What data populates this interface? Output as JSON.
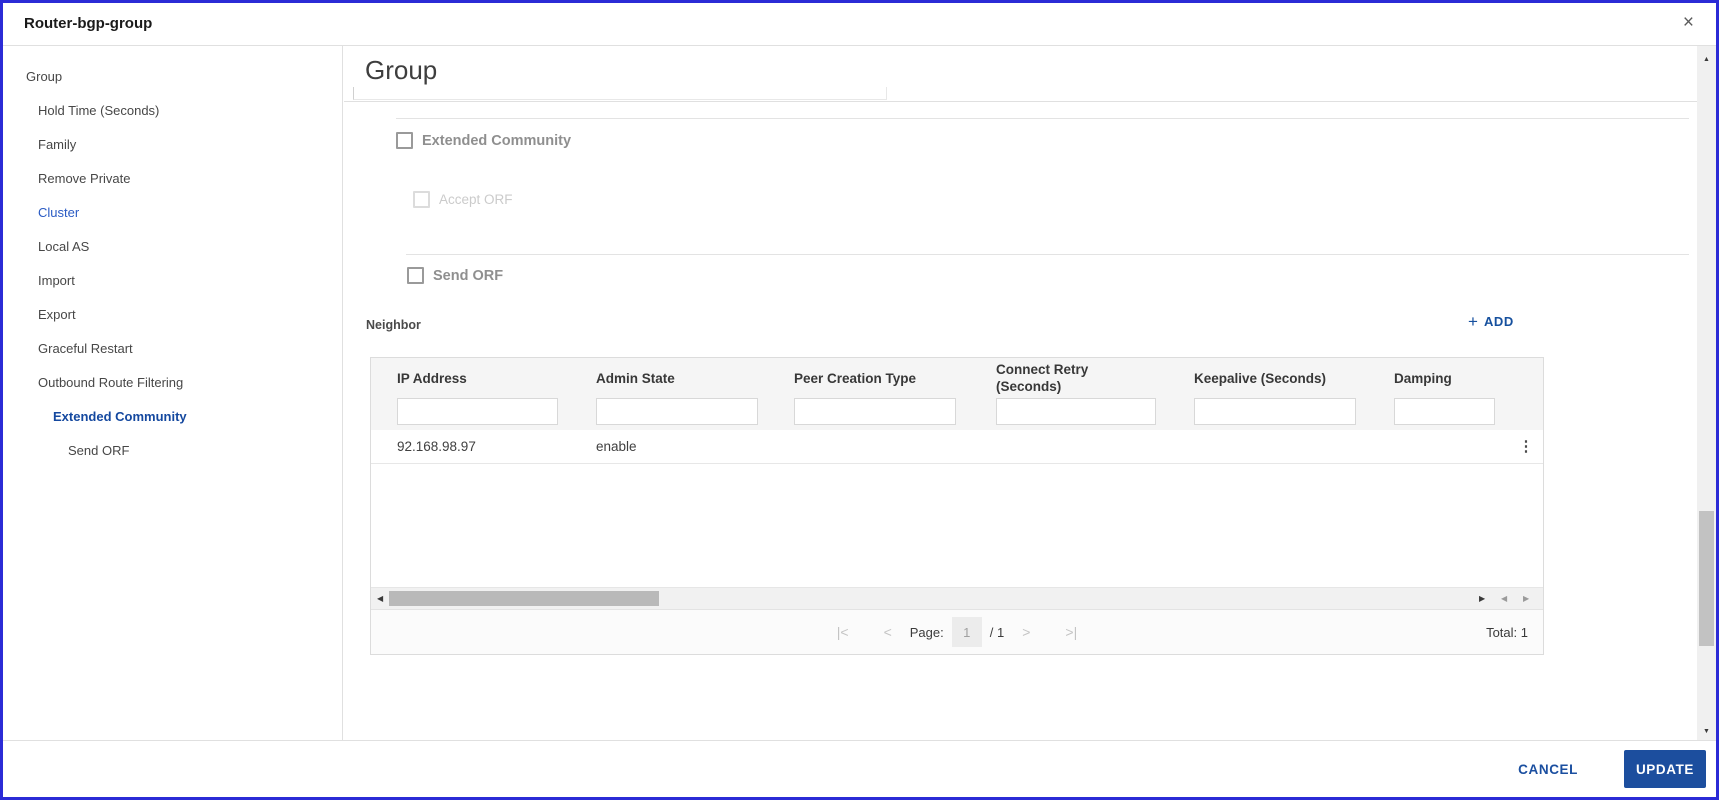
{
  "modal": {
    "title": "Router-bgp-group",
    "close_icon": "×"
  },
  "sidebar": {
    "items": [
      {
        "label": "Group",
        "level": 0,
        "style": "normal"
      },
      {
        "label": "Hold Time (Seconds)",
        "level": 1,
        "style": "normal"
      },
      {
        "label": "Family",
        "level": 1,
        "style": "normal"
      },
      {
        "label": "Remove Private",
        "level": 1,
        "style": "normal"
      },
      {
        "label": "Cluster",
        "level": 1,
        "style": "link"
      },
      {
        "label": "Local AS",
        "level": 1,
        "style": "normal"
      },
      {
        "label": "Import",
        "level": 1,
        "style": "normal"
      },
      {
        "label": "Export",
        "level": 1,
        "style": "normal"
      },
      {
        "label": "Graceful Restart",
        "level": 1,
        "style": "normal"
      },
      {
        "label": "Outbound Route Filtering",
        "level": 1,
        "style": "normal"
      },
      {
        "label": "Extended Community",
        "level": 2,
        "style": "active"
      },
      {
        "label": "Send ORF",
        "level": 3,
        "style": "normal"
      }
    ]
  },
  "content": {
    "heading": "Group",
    "checkboxes": {
      "extended_community": {
        "label": "Extended Community",
        "checked": false,
        "disabled": false
      },
      "accept_orf": {
        "label": "Accept ORF",
        "checked": false,
        "disabled": true
      },
      "send_orf": {
        "label": "Send ORF",
        "checked": false,
        "disabled": false
      }
    },
    "neighbor": {
      "section_label": "Neighbor",
      "add_button": {
        "plus_icon": "+",
        "label": "ADD"
      },
      "table": {
        "columns": [
          {
            "label": "IP Address",
            "filter_value": ""
          },
          {
            "label": "Admin State",
            "filter_value": ""
          },
          {
            "label": "Peer Creation Type",
            "filter_value": ""
          },
          {
            "label": "Connect Retry (Seconds)",
            "filter_value": ""
          },
          {
            "label": "Keepalive (Seconds)",
            "filter_value": ""
          },
          {
            "label": "Damping",
            "filter_value": ""
          }
        ],
        "rows": [
          {
            "cells": [
              "92.168.98.97",
              "enable",
              "",
              "",
              "",
              ""
            ],
            "kebab_icon": "⋮"
          }
        ]
      },
      "scrollbar": {
        "left_arrow": "◀",
        "right_arrow": "▶",
        "prev_col_arrow": "◀",
        "next_col_arrow": "▶"
      },
      "pagination": {
        "first_icon": "|<",
        "prev_icon": "<",
        "page_label": "Page:",
        "page_value": "1",
        "page_total": "/ 1",
        "next_icon": ">",
        "last_icon": ">|",
        "total_text": "Total: 1"
      }
    }
  },
  "footer": {
    "cancel_label": "CANCEL",
    "update_label": "UPDATE"
  },
  "vertical_scrollbar": {
    "up_icon": "▲",
    "down_icon": "▼"
  },
  "colors": {
    "modal_border": "#2b2bd6",
    "link_blue": "#2a5bc4",
    "active_nav_blue": "#14489f",
    "action_blue": "#16509e",
    "update_button_bg": "#1c4e9e",
    "section_label_gray": "#8f8f8f",
    "disabled_gray": "#cbcbcb",
    "table_header_bg": "#f5f5f5"
  }
}
